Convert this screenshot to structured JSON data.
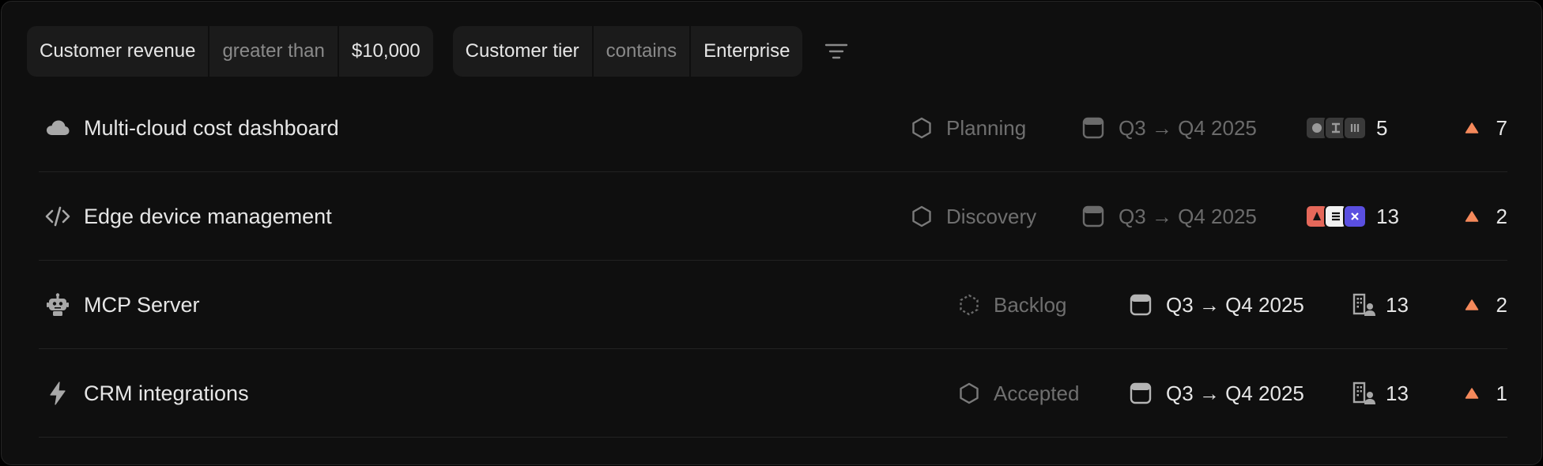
{
  "filters": [
    {
      "field": "Customer revenue",
      "operator": "greater than",
      "value": "$10,000"
    },
    {
      "field": "Customer tier",
      "operator": "contains",
      "value": "Enterprise"
    }
  ],
  "rows": [
    {
      "icon": "cloud-icon",
      "title": "Multi-cloud cost dashboard",
      "status": "Planning",
      "status_icon": "hexagon-icon",
      "timeline": "Q3 → Q4 2025",
      "timeline_dim": true,
      "count": "5",
      "count_icon": "avatar-stack-icon",
      "priority": "7"
    },
    {
      "icon": "code-icon",
      "title": "Edge device management",
      "status": "Discovery",
      "status_icon": "hexagon-icon",
      "timeline": "Q3 → Q4 2025",
      "timeline_dim": true,
      "count": "13",
      "count_icon": "avatar-stack-icon",
      "priority": "2"
    },
    {
      "icon": "robot-icon",
      "title": "MCP Server",
      "status": "Backlog",
      "status_icon": "dashed-hexagon-icon",
      "timeline": "Q3 → Q4 2025",
      "timeline_dim": false,
      "count": "13",
      "count_icon": "building-user-icon",
      "priority": "2"
    },
    {
      "icon": "lightning-icon",
      "title": "CRM integrations",
      "status": "Accepted",
      "status_icon": "hexagon-icon",
      "timeline": "Q3 → Q4 2025",
      "timeline_dim": false,
      "count": "13",
      "count_icon": "building-user-icon",
      "priority": "1"
    }
  ],
  "colors": {
    "priority": "#f5895b",
    "avatar_red": "#e5685a",
    "avatar_white": "#f2f2f2",
    "avatar_blue": "#5a4fe0",
    "avatar_gray": "#3a3a3a"
  }
}
